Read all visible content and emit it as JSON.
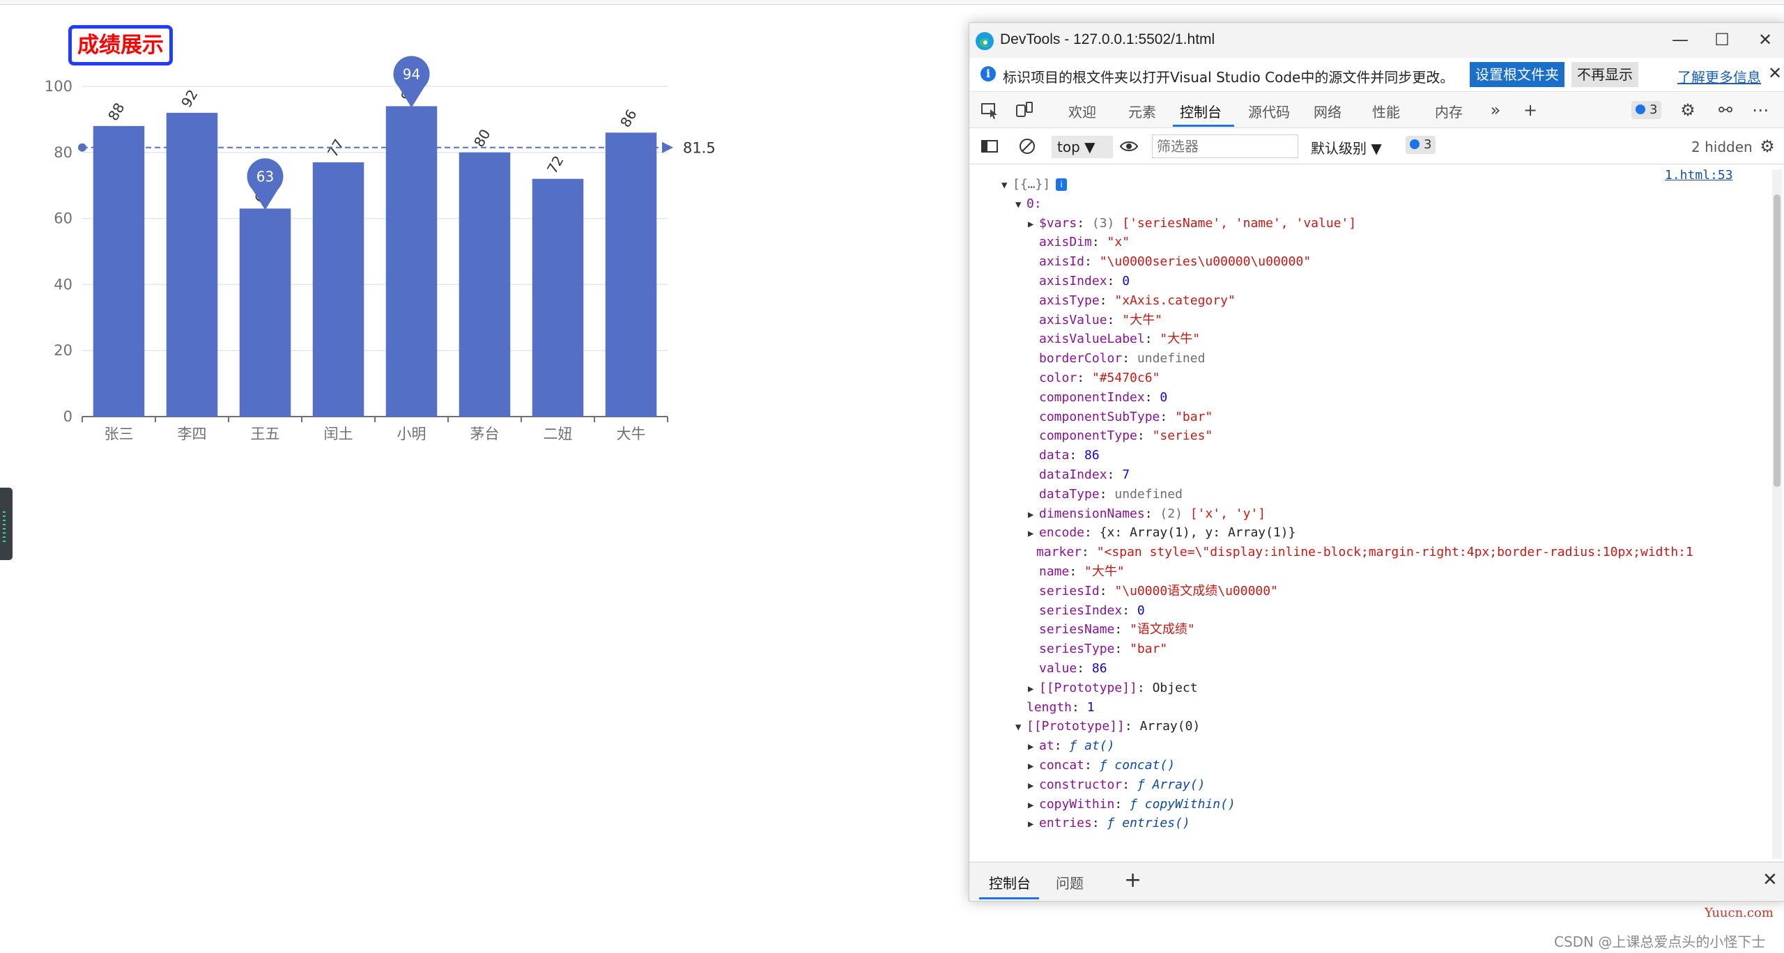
{
  "chart": {
    "title": "成绩展示",
    "mark_line_label": "81.5",
    "colors": {
      "bar": "#5470c6",
      "title_text": "#ff0000",
      "title_border": "#1f3cff"
    }
  },
  "chart_data": {
    "type": "bar",
    "categories": [
      "张三",
      "李四",
      "王五",
      "闰土",
      "小明",
      "茅台",
      "二妞",
      "大牛"
    ],
    "series": [
      {
        "values": [
          88,
          92,
          63,
          77,
          94,
          80,
          72,
          86
        ]
      }
    ],
    "y_ticks": [
      0,
      20,
      40,
      60,
      80,
      100
    ],
    "ylim": [
      0,
      100
    ],
    "mark_points": {
      "max": 94,
      "min": 63
    },
    "mark_line": {
      "value": 81.5
    },
    "grid": true
  },
  "devtools": {
    "window_title": "DevTools - 127.0.0.1:5502/1.html",
    "infobar": {
      "text": "标识项目的根文件夹以打开Visual Studio Code中的源文件并同步更改。",
      "primary_button": "设置根文件夹",
      "secondary_button": "不再显示",
      "link": "了解更多信息"
    },
    "tabs": [
      "欢迎",
      "元素",
      "控制台",
      "源代码",
      "网络",
      "性能",
      "内存"
    ],
    "active_tab": "控制台",
    "issues_count": "3",
    "console_bar": {
      "context": "top",
      "filter_placeholder": "筛选器",
      "level": "默认级别",
      "issues_count": "3",
      "hidden": "2 hidden"
    },
    "source_link": "1.html:53",
    "drawer_tabs": [
      "控制台",
      "问题"
    ]
  },
  "console": {
    "root_label": "[{…}]",
    "index0": "0:",
    "vars_line": "['seriesName', 'name', 'value']",
    "vars_count": "(3)",
    "props": [
      {
        "k": "axisDim",
        "v": "\"x\"",
        "t": "s"
      },
      {
        "k": "axisId",
        "v": "\"\\u0000series\\u00000\\u00000\"",
        "t": "s"
      },
      {
        "k": "axisIndex",
        "v": "0",
        "t": "n"
      },
      {
        "k": "axisType",
        "v": "\"xAxis.category\"",
        "t": "s"
      },
      {
        "k": "axisValue",
        "v": "\"大牛\"",
        "t": "s"
      },
      {
        "k": "axisValueLabel",
        "v": "\"大牛\"",
        "t": "s"
      },
      {
        "k": "borderColor",
        "v": "undefined",
        "t": "u"
      },
      {
        "k": "color",
        "v": "\"#5470c6\"",
        "t": "s"
      },
      {
        "k": "componentIndex",
        "v": "0",
        "t": "n"
      },
      {
        "k": "componentSubType",
        "v": "\"bar\"",
        "t": "s"
      },
      {
        "k": "componentType",
        "v": "\"series\"",
        "t": "s"
      },
      {
        "k": "data",
        "v": "86",
        "t": "n"
      },
      {
        "k": "dataIndex",
        "v": "7",
        "t": "n"
      },
      {
        "k": "dataType",
        "v": "undefined",
        "t": "u"
      }
    ],
    "dimension_names": "['x', 'y']",
    "dimension_count": "(2)",
    "encode": "{x: Array(1), y: Array(1)}",
    "marker": "\"<span style=\\\"display:inline-block;margin-right:4px;border-radius:10px;width:1",
    "props2": [
      {
        "k": "name",
        "v": "\"大牛\"",
        "t": "s"
      },
      {
        "k": "seriesId",
        "v": "\"\\u0000语文成绩\\u00000\"",
        "t": "s"
      },
      {
        "k": "seriesIndex",
        "v": "0",
        "t": "n"
      },
      {
        "k": "seriesName",
        "v": "\"语文成绩\"",
        "t": "s"
      },
      {
        "k": "seriesType",
        "v": "\"bar\"",
        "t": "s"
      },
      {
        "k": "value",
        "v": "86",
        "t": "n"
      }
    ],
    "prototype_object": "Object",
    "length": "1",
    "prototype_array": "Array(0)",
    "methods": [
      {
        "k": "at",
        "v": "at()"
      },
      {
        "k": "concat",
        "v": "concat()"
      },
      {
        "k": "constructor",
        "v": "Array()"
      },
      {
        "k": "copyWithin",
        "v": "copyWithin()"
      },
      {
        "k": "entries",
        "v": "entries()"
      }
    ]
  },
  "watermarks": {
    "site": "Yuucn.com",
    "csdn": "CSDN @上课总爱点头的小怪下士"
  }
}
